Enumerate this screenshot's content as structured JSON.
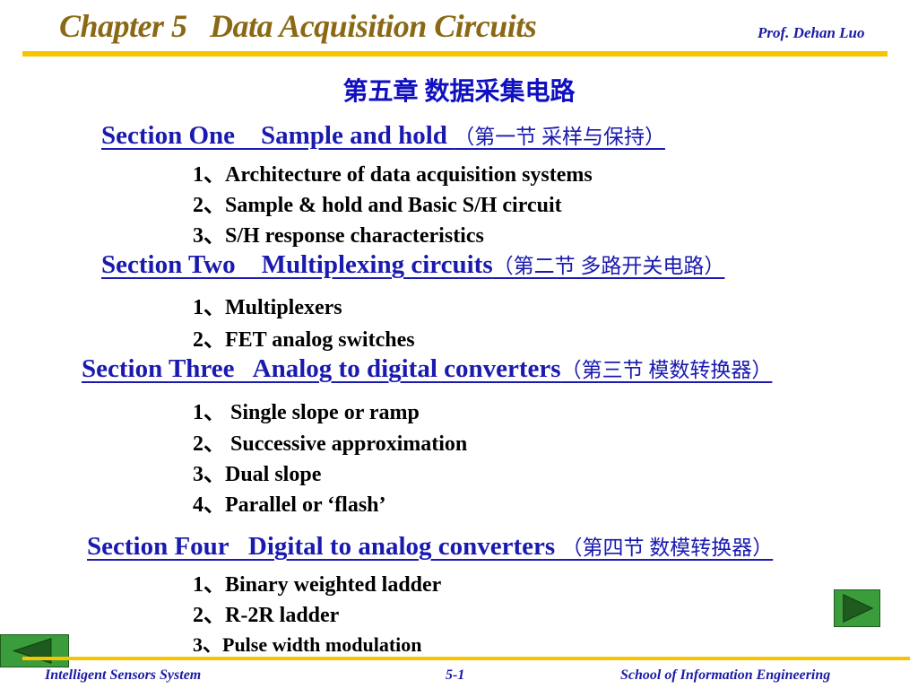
{
  "header": {
    "chapter_title": "Chapter 5   Data Acquisition Circuits",
    "author": "Prof. Dehan Luo"
  },
  "chinese_title": "第五章 数据采集电路",
  "sections": [
    {
      "title": "Section One    Sample and hold ",
      "title_cn": "（第一节 采样与保持）",
      "items": [
        "1、Architecture of data acquisition systems",
        "2、Sample & hold and Basic S/H circuit",
        "3、S/H response characteristics"
      ]
    },
    {
      "title": "Section Two    Multiplexing circuits",
      "title_cn": "（第二节 多路开关电路）",
      "items": [
        "1、Multiplexers",
        "2、FET analog switches"
      ]
    },
    {
      "title": "Section Three   Analog to digital converters",
      "title_cn": "（第三节 模数转换器）",
      "items": [
        "1、 Single slope or ramp",
        "2、 Successive approximation",
        "3、Dual slope",
        "4、Parallel or ‘flash’"
      ]
    },
    {
      "title": "Section Four   Digital to analog converters ",
      "title_cn": "（第四节 数模转换器）",
      "items": [
        "1、Binary weighted ladder",
        "2、R-2R ladder",
        "3、Pulse width modulation"
      ]
    }
  ],
  "navigation": {
    "prev_icon": "triangle-left-icon",
    "next_icon": "triangle-right-icon"
  },
  "footer": {
    "left": "Intelligent Sensors System",
    "center": "5-1",
    "right": "School of Information Engineering"
  },
  "colors": {
    "title": "#8B6914",
    "accent_rule": "#f7c500",
    "section": "#1a1ab0",
    "nav_button": "#3a9c3a"
  }
}
